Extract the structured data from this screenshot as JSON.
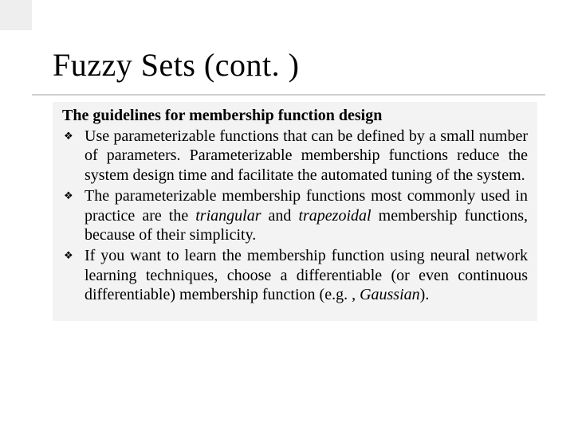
{
  "slide": {
    "title": "Fuzzy Sets (cont. )",
    "lead": "The guidelines for membership function design",
    "bullet_glyph": "❖",
    "bullets": [
      {
        "text": "Use parameterizable functions that can be defined by a small number of parameters. Parameterizable membership functions reduce the system design time and facilitate the automated tuning of the system."
      },
      {
        "pre": "The parameterizable membership functions most commonly used in practice are the ",
        "em1": "triangular",
        "mid": " and ",
        "em2": "trapezoidal",
        "post": " membership functions, because of their simplicity."
      },
      {
        "pre": "If you want to learn the membership function using neural network learning techniques, choose a differentiable (or even continuous differentiable) membership function (e.g. , ",
        "em1": "Gaussian",
        "post": ")."
      }
    ]
  }
}
